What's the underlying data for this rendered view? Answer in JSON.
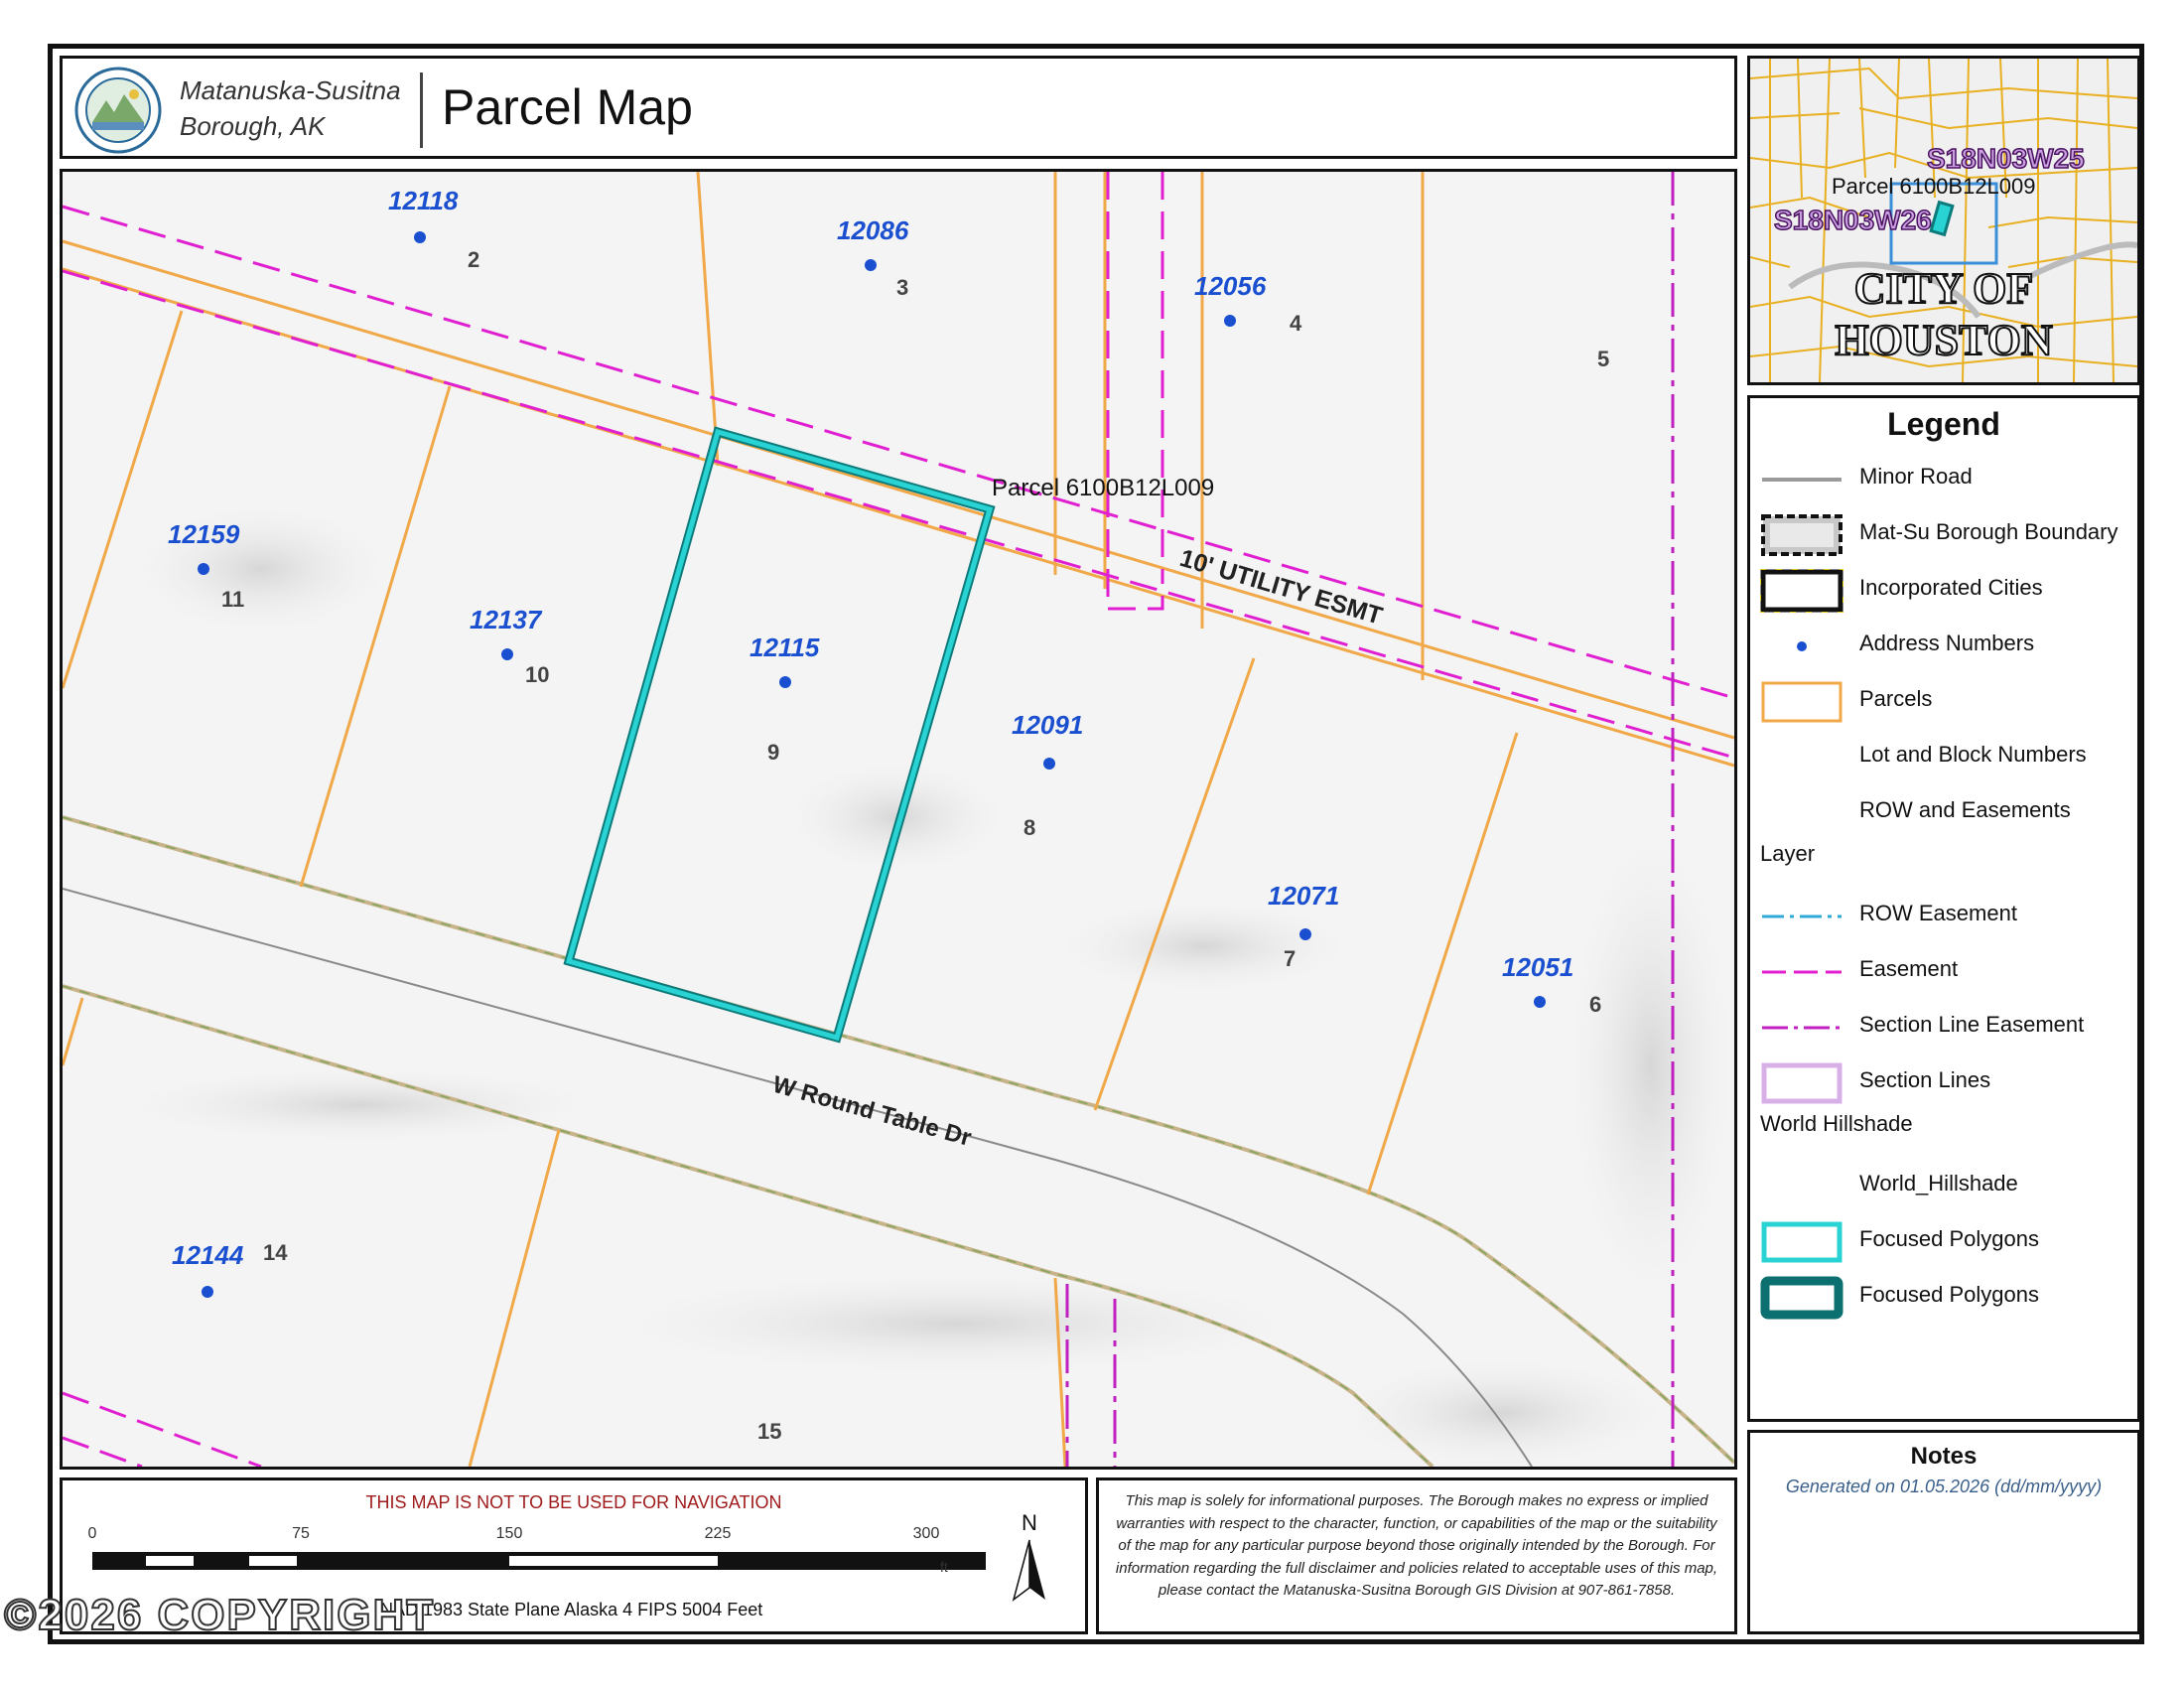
{
  "header": {
    "org_line1": "Matanuska-Susitna",
    "org_line2": "Borough, AK",
    "title": "Parcel Map"
  },
  "map": {
    "address_numbers": [
      "12118",
      "12086",
      "12056",
      "12159",
      "12137",
      "12115",
      "12091",
      "12071",
      "12051",
      "12144"
    ],
    "lot_numbers": [
      "2",
      "3",
      "4",
      "5",
      "11",
      "10",
      "9",
      "8",
      "7",
      "6",
      "14",
      "15"
    ],
    "focused_parcel_label": "Parcel 6100B12L009",
    "easement_label": "10' UTILITY ESMT",
    "road_label": "W Round Table Dr"
  },
  "inset": {
    "section_a": "S18N03W25",
    "section_b": "S18N03W26",
    "parcel_label": "Parcel 6100B12L009",
    "city_line1": "CITY OF",
    "city_line2": "HOUSTON"
  },
  "legend": {
    "title": "Legend",
    "items": [
      {
        "label": "Minor Road",
        "symbol": "minor-road"
      },
      {
        "label": "Mat-Su Borough Boundary",
        "symbol": "borough-boundary"
      },
      {
        "label": "Incorporated Cities",
        "symbol": "incorporated-cities"
      },
      {
        "label": "Address Numbers",
        "symbol": "address-dot"
      },
      {
        "label": "Parcels",
        "symbol": "parcel-box"
      },
      {
        "label": "Lot and Block Numbers",
        "symbol": "none"
      },
      {
        "label": "ROW and Easements",
        "symbol": "none"
      }
    ],
    "group_layer": "Layer",
    "layer_items": [
      {
        "label": "ROW Easement",
        "symbol": "row-easement"
      },
      {
        "label": "Easement",
        "symbol": "easement"
      },
      {
        "label": "Section Line Easement",
        "symbol": "section-line-easement"
      },
      {
        "label": "Section Lines",
        "symbol": "section-lines"
      }
    ],
    "group_hillshade": "World Hillshade",
    "hillshade_items": [
      {
        "label": "World_Hillshade",
        "symbol": "none"
      },
      {
        "label": "Focused Polygons",
        "symbol": "focused-cyan"
      },
      {
        "label": "Focused Polygons",
        "symbol": "focused-teal"
      }
    ]
  },
  "notes": {
    "title": "Notes",
    "generated": "Generated on 01.05.2026 (dd/mm/yyyy)"
  },
  "scalebar": {
    "warning": "THIS MAP IS NOT TO BE USED FOR NAVIGATION",
    "ticks": [
      "0",
      "75",
      "150",
      "225",
      "300"
    ],
    "unit": "ft",
    "north": "N",
    "projection": "NAD 1983 State Plane Alaska 4 FIPS 5004 Feet"
  },
  "disclaimer": "This map is solely for informational purposes. The Borough makes no express or implied warranties with respect to the character, function, or capabilities of the map or the suitability of the map for any particular purpose beyond those originally intended by the Borough. For information regarding the full disclaimer and policies related to acceptable uses of this map, please contact the Matanuska-Susitna Borough GIS Division at 907-861-7858.",
  "copyright": "©2026 COPYRIGHT",
  "colors": {
    "parcel": "#f0a848",
    "easement": "#e020d0",
    "focused": "#29d3d3",
    "address": "#1a4fd0",
    "road": "#8a8a8a"
  }
}
